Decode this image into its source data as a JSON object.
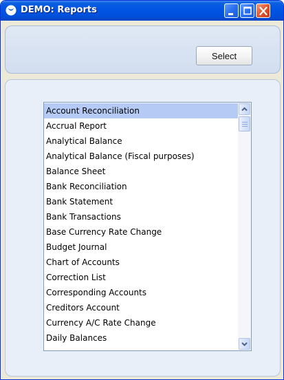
{
  "window": {
    "title": "DEMO: Reports",
    "controls": [
      "minimize",
      "maximize",
      "close"
    ]
  },
  "toolbar": {
    "select_label": "Select"
  },
  "report_list": {
    "selected_index": 0,
    "items": [
      "Account Reconciliation",
      "Accrual Report",
      "Analytical Balance",
      "Analytical Balance (Fiscal purposes)",
      "Balance Sheet",
      "Bank Reconciliation",
      "Bank Statement",
      "Bank Transactions",
      "Base Currency Rate Change",
      "Budget Journal",
      "Chart of Accounts",
      "Correction List",
      "Corresponding Accounts",
      "Creditors Account",
      "Currency A/C Rate Change",
      "Daily Balances"
    ]
  },
  "colors": {
    "titlebar": "#0054e3",
    "selection": "#b5cbf5",
    "window_bg": "#ece9d8"
  }
}
